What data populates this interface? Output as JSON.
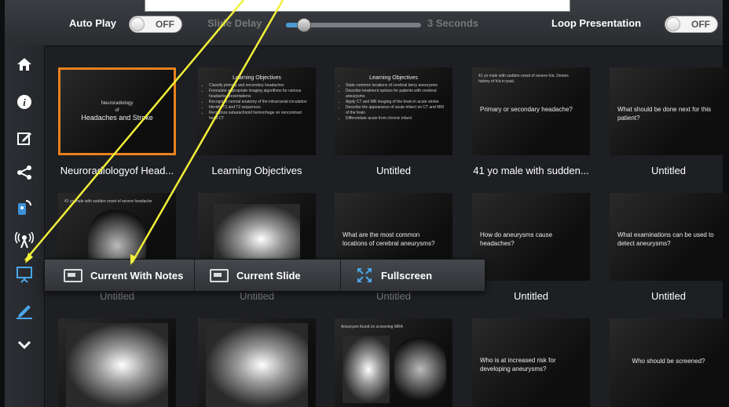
{
  "colors": {
    "accent": "#4aa6e8",
    "selected_border": "#e8821e",
    "annotation_arrow": "#f2f03a"
  },
  "topbar": {
    "auto_play_label": "Auto Play",
    "auto_play_state": "OFF",
    "slide_delay_label": "Slide Delay",
    "slide_delay_value": "3 Seconds",
    "loop_label": "Loop Presentation",
    "loop_state": "OFF"
  },
  "sidebar": {
    "icons": [
      "home-icon",
      "info-icon",
      "edit-icon",
      "share-icon",
      "remote-icon",
      "broadcast-icon",
      "present-icon",
      "pen-icon",
      "chevron-down-icon"
    ],
    "selected": "present-icon"
  },
  "slides": [
    {
      "caption": "Neuroradiologyof Head...",
      "line1": "Neuroradiology",
      "line2": "of",
      "line3": "Headaches and Stroke"
    },
    {
      "caption": "Learning Objectives",
      "heading": "Learning Objectives",
      "bullets": [
        "Classify primary and secondary headaches",
        "Formulate appropriate imaging algorithms for various headache presentations",
        "Recognize normal anatomy of the intracranial circulation",
        "Identify T1 and T2 sequences",
        "Recognize subarachnoid hemorrhage on noncontrast head CT"
      ]
    },
    {
      "caption": "Untitled",
      "heading": "Learning Objectives",
      "bullets": [
        "State common locations of cerebral berry aneurysms",
        "Describe treatment options for patients with cerebral aneurysms",
        "Apply CT and MR imaging of the brain in acute stroke",
        "Describe the appearance of acute infarct on CT and MRI of the brain",
        "Differentiate acute from chronic infarct"
      ]
    },
    {
      "caption": "41 yo male with sudden...",
      "small": "41 yo male with sudden onset of severe h/a. Denies history of h/a in past.",
      "question": "Primary or secondary headache?"
    },
    {
      "caption": "Untitled",
      "question": "What should be done next for this patient?"
    },
    {
      "caption": "Untitled",
      "small": "41 yo male with sudden onset of severe headache"
    },
    {
      "caption": "Untitled"
    },
    {
      "caption": "Untitled",
      "question": "What are the most common locations of cerebral aneurysms?"
    },
    {
      "caption": "Untitled",
      "question": "How do aneurysms cause headaches?"
    },
    {
      "caption": "Untitled",
      "question": "What examinations can be used to detect aneurysms?"
    },
    {
      "caption": ""
    },
    {
      "caption": ""
    },
    {
      "caption": "",
      "small": "Aneurysm found on screening MRA"
    },
    {
      "caption": "",
      "question": "Who is at increased risk for developing aneurysms?"
    },
    {
      "caption": "",
      "question": "Who should be screened?"
    }
  ],
  "present_menu": {
    "items": [
      {
        "label": "Current With Notes",
        "icon": "screen-notes-icon"
      },
      {
        "label": "Current Slide",
        "icon": "screen-icon"
      },
      {
        "label": "Fullscreen",
        "icon": "fullscreen-icon"
      }
    ]
  }
}
